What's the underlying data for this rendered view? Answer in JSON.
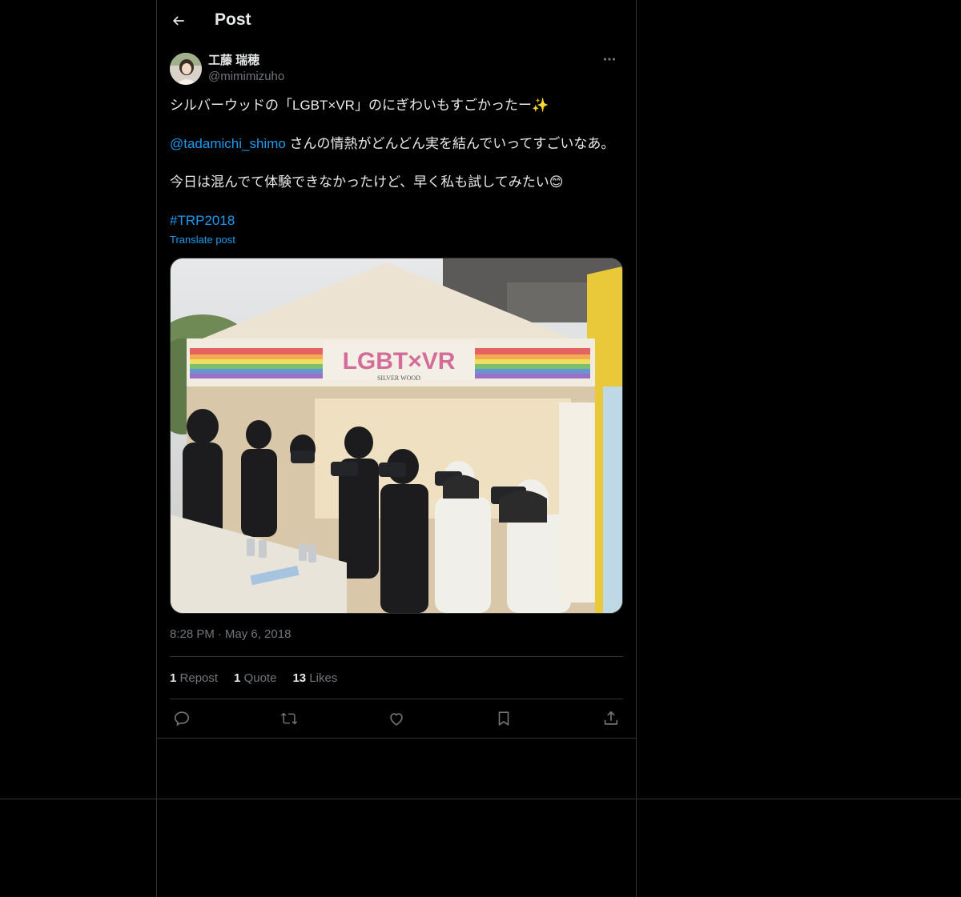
{
  "header": {
    "title": "Post"
  },
  "tweet": {
    "author": {
      "display_name": "工藤 瑞穂",
      "handle": "@mimimizuho"
    },
    "text": {
      "line1": "シルバーウッドの「LGBT×VR」のにぎわいもすごかったー✨",
      "mention": "@tadamichi_shimo",
      "line2_rest": " さんの情熱がどんどん実を結んでいってすごいなあ。",
      "line3": "今日は混んでて体験できなかったけど、早く私も試してみたい😊",
      "hashtag": "#TRP2018"
    },
    "translate_label": "Translate post",
    "media": {
      "banner_text": "LGBT×VR",
      "banner_subtext": "SILVER WOOD"
    },
    "time": "8:28 PM",
    "date": "May 6, 2018",
    "stats": {
      "reposts_count": "1",
      "reposts_label": "Repost",
      "quotes_count": "1",
      "quotes_label": "Quote",
      "likes_count": "13",
      "likes_label": "Likes"
    }
  },
  "colors": {
    "background": "#000000",
    "text": "#e7e9ea",
    "secondary": "#71767b",
    "link": "#1d9bf0",
    "border": "#2f3336"
  },
  "icons": [
    "back-arrow-icon",
    "more-icon",
    "reply-icon",
    "repost-icon",
    "like-icon",
    "bookmark-icon",
    "share-icon"
  ]
}
